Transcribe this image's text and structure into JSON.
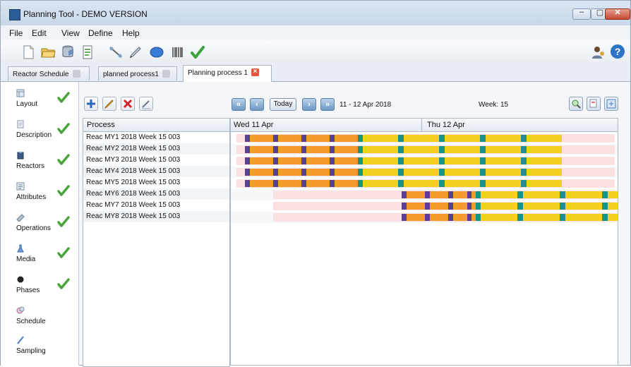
{
  "window": {
    "title": "Planning Tool - DEMO VERSION",
    "controls": {
      "minimize": "–",
      "maximize": "▢",
      "close": "✕"
    }
  },
  "menu": [
    "File",
    "Edit",
    "View",
    "Define",
    "Help"
  ],
  "toolbar": {
    "icons": [
      "new-document-icon",
      "open-folder-icon",
      "database-icon",
      "checklist-icon",
      "connector-icon",
      "pen-icon",
      "ellipse-icon",
      "barcode-icon",
      "check-icon"
    ],
    "right_icons": [
      "users-icon",
      "help-icon"
    ],
    "help_glyph": "?"
  },
  "tabs": [
    {
      "label": "Reactor Schedule",
      "active": false
    },
    {
      "label": "planned process1",
      "active": false
    },
    {
      "label": "Planning process 1",
      "active": true
    }
  ],
  "tab_close_glyph": "×",
  "nav": [
    {
      "label": "Layout",
      "icon": "layout-icon",
      "checked": true
    },
    {
      "label": "Description",
      "icon": "description-icon",
      "checked": true
    },
    {
      "label": "Reactors",
      "icon": "reactor-icon",
      "checked": true
    },
    {
      "label": "Attributes",
      "icon": "attributes-icon",
      "checked": true
    },
    {
      "label": "Operations",
      "icon": "operations-icon",
      "checked": true
    },
    {
      "label": "Media",
      "icon": "media-icon",
      "checked": true
    },
    {
      "label": "Phases",
      "icon": "phases-icon",
      "checked": true
    },
    {
      "label": "Schedule",
      "icon": "schedule-icon",
      "checked": false
    },
    {
      "label": "Sampling",
      "icon": "sampling-icon",
      "checked": false
    }
  ],
  "process_panel": {
    "buttons": [
      "add-icon",
      "edit-icon",
      "delete-icon",
      "rename-icon"
    ],
    "column_header": "Process",
    "rows": [
      "Reac MY1 2018 Week 15 003",
      "Reac MY2 2018 Week 15 003",
      "Reac MY3 2018 Week 15 003",
      "Reac MY4 2018 Week 15 003",
      "Reac MY5 2018 Week 15 003",
      "Reac MY6 2018 Week 15 003",
      "Reac MY7 2018 Week 15 003",
      "Reac MY8 2018 Week 15 003"
    ]
  },
  "gantt": {
    "nav_buttons": [
      {
        "name": "first-button",
        "glyph": "«"
      },
      {
        "name": "prev-button",
        "glyph": "‹"
      },
      {
        "name": "next-button",
        "glyph": "›"
      },
      {
        "name": "last-button",
        "glyph": "»"
      }
    ],
    "today_label": "Today",
    "date_range": "11 - 12 Apr 2018",
    "week_label": "Week: 15",
    "zoom_buttons": [
      "zoom-in-icon",
      "zoom-out-icon",
      "fit-icon"
    ],
    "days": [
      "Wed 11 Apr",
      "Thu 12 Apr"
    ],
    "colors": {
      "purple": "#5b3f95",
      "orange": "#f29a2e",
      "teal": "#1f8f8a",
      "yellow": "#f3d21f",
      "pink": "#fbe1e1",
      "check": "#4aa53c"
    }
  }
}
